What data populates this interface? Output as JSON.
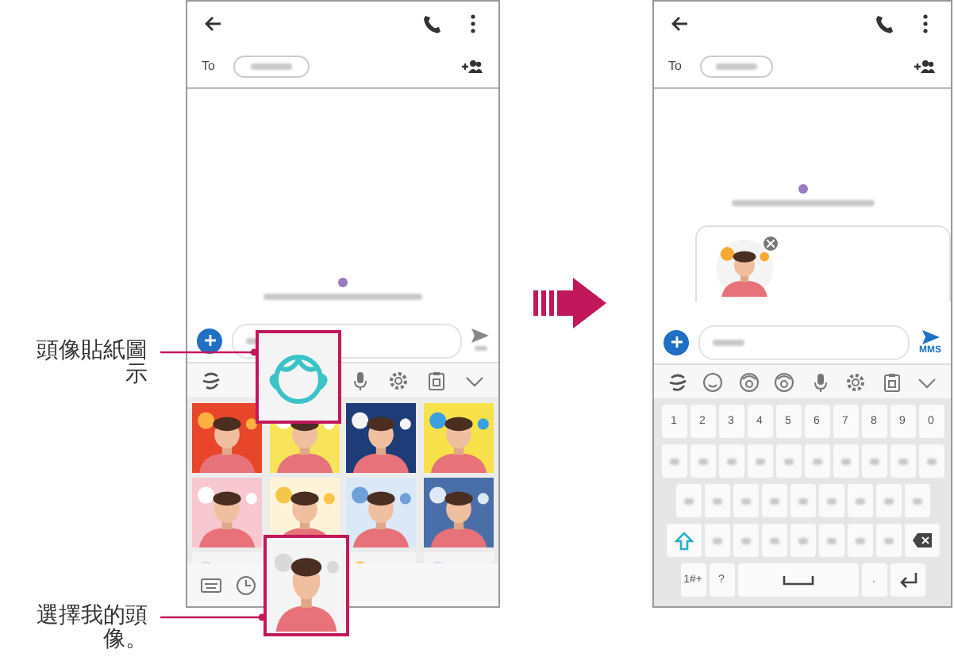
{
  "callouts": [
    {
      "text": "頭像貼紙圖示"
    },
    {
      "text": "選擇我的頭像。"
    }
  ],
  "left_phone": {
    "to_label": "To"
  },
  "right_phone": {
    "to_label": "To",
    "send_label": "MMS",
    "keyboard": [
      [
        {
          "kind": "text",
          "label": "1"
        },
        {
          "kind": "text",
          "label": "2"
        },
        {
          "kind": "text",
          "label": "3"
        },
        {
          "kind": "text",
          "label": "4"
        },
        {
          "kind": "text",
          "label": "5"
        },
        {
          "kind": "text",
          "label": "6"
        },
        {
          "kind": "text",
          "label": "7"
        },
        {
          "kind": "text",
          "label": "8"
        },
        {
          "kind": "text",
          "label": "9"
        },
        {
          "kind": "text",
          "label": "0"
        }
      ],
      [
        {
          "kind": "blank"
        },
        {
          "kind": "blank"
        },
        {
          "kind": "blank"
        },
        {
          "kind": "blank"
        },
        {
          "kind": "blank"
        },
        {
          "kind": "blank"
        },
        {
          "kind": "blank"
        },
        {
          "kind": "blank"
        },
        {
          "kind": "blank"
        },
        {
          "kind": "blank"
        }
      ],
      [
        {
          "kind": "blank"
        },
        {
          "kind": "blank"
        },
        {
          "kind": "blank"
        },
        {
          "kind": "blank"
        },
        {
          "kind": "blank"
        },
        {
          "kind": "blank"
        },
        {
          "kind": "blank"
        },
        {
          "kind": "blank"
        },
        {
          "kind": "blank"
        }
      ],
      [
        {
          "kind": "shift"
        },
        {
          "kind": "blank"
        },
        {
          "kind": "blank"
        },
        {
          "kind": "blank"
        },
        {
          "kind": "blank"
        },
        {
          "kind": "blank"
        },
        {
          "kind": "blank"
        },
        {
          "kind": "blank"
        },
        {
          "kind": "backspace"
        }
      ],
      [
        {
          "kind": "text",
          "label": "1#+"
        },
        {
          "kind": "text",
          "label": "?"
        },
        {
          "kind": "space"
        },
        {
          "kind": "text",
          "label": "."
        },
        {
          "kind": "enter"
        }
      ]
    ]
  }
}
